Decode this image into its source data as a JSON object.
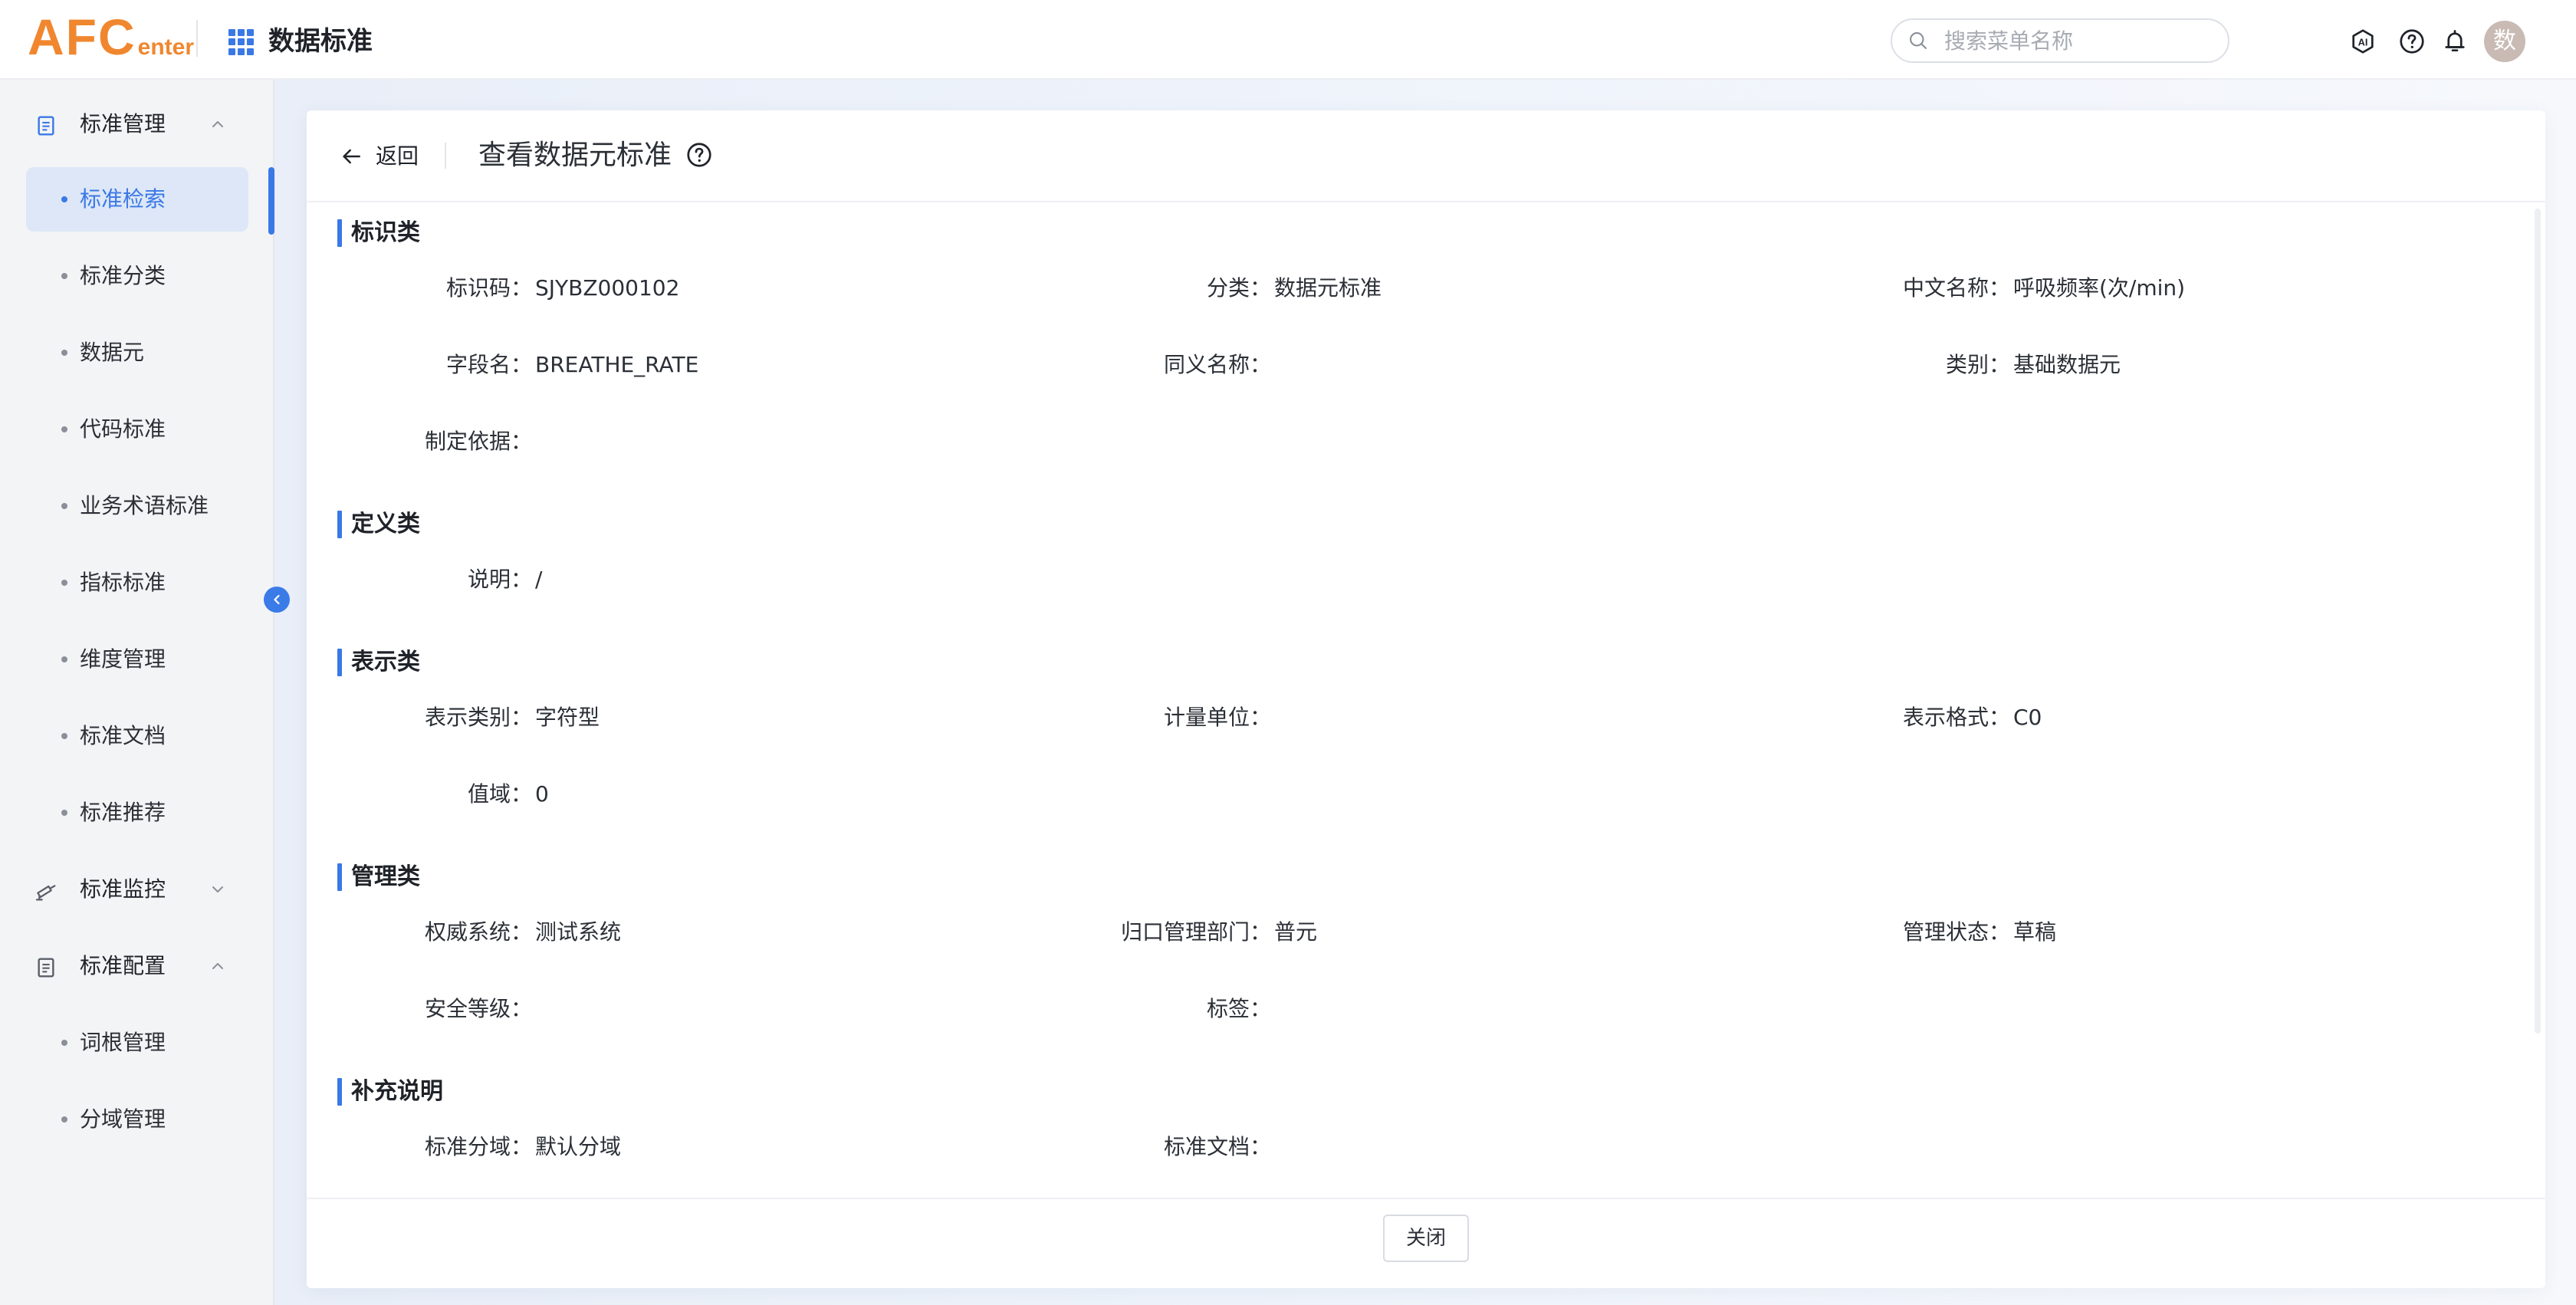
{
  "header": {
    "logo_big": "AFC",
    "logo_small": "enter",
    "app_title": "数据标准",
    "search_placeholder": "搜索菜单名称",
    "avatar_text": "数",
    "icons": [
      "ai-icon",
      "help-icon",
      "bell-icon"
    ]
  },
  "sidebar": {
    "groups": [
      {
        "label": "标准管理",
        "icon": "document-icon",
        "expanded": true
      },
      {
        "label": "标准监控",
        "icon": "monitor-icon",
        "expanded": false
      },
      {
        "label": "标准配置",
        "icon": "document-icon",
        "expanded": true
      }
    ],
    "items": [
      {
        "label": "标准检索",
        "active": true
      },
      {
        "label": "标准分类"
      },
      {
        "label": "数据元"
      },
      {
        "label": "代码标准"
      },
      {
        "label": "业务术语标准"
      },
      {
        "label": "指标标准"
      },
      {
        "label": "维度管理"
      },
      {
        "label": "标准文档"
      },
      {
        "label": "标准推荐"
      },
      {
        "label": "词根管理"
      },
      {
        "label": "分域管理"
      }
    ]
  },
  "page": {
    "back_label": "返回",
    "title": "查看数据元标准",
    "close_label": "关闭"
  },
  "sections": {
    "identification": {
      "title": "标识类",
      "code_label": "标识码：",
      "code_value": "SJYBZ000102",
      "category_label": "分类：",
      "category_value": "数据元标准",
      "cn_name_label": "中文名称：",
      "cn_name_value": "呼吸频率(次/min)",
      "field_name_label": "字段名：",
      "field_name_value": "BREATHE_RATE",
      "synonym_label": "同义名称：",
      "synonym_value": "",
      "type_label": "类别：",
      "type_value": "基础数据元",
      "basis_label": "制定依据：",
      "basis_value": ""
    },
    "definition": {
      "title": "定义类",
      "desc_label": "说明：",
      "desc_value": "/"
    },
    "representation": {
      "title": "表示类",
      "rep_type_label": "表示类别：",
      "rep_type_value": "字符型",
      "unit_label": "计量单位：",
      "unit_value": "",
      "format_label": "表示格式：",
      "format_value": "C0",
      "range_label": "值域：",
      "range_value": "0"
    },
    "management": {
      "title": "管理类",
      "authority_label": "权威系统：",
      "authority_value": "测试系统",
      "dept_label": "归口管理部门：",
      "dept_value": "普元",
      "status_label": "管理状态：",
      "status_value": "草稿",
      "security_label": "安全等级：",
      "security_value": "",
      "tag_label": "标签：",
      "tag_value": ""
    },
    "supplement": {
      "title": "补充说明",
      "domain_label": "标准分域：",
      "domain_value": "默认分域",
      "doc_label": "标准文档：",
      "doc_value": ""
    }
  },
  "colors": {
    "accent": "#3a78e6",
    "logo": "#f0872f",
    "active_bg": "#dde7f7",
    "sidebar_bg": "#f3f4f6"
  }
}
